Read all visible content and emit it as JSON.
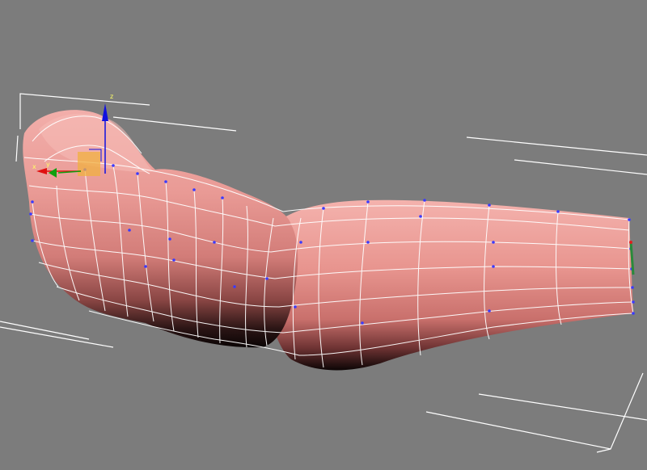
{
  "viewport": {
    "background": "#7c7c7c",
    "view": "perspective"
  },
  "model": {
    "type": "editable-poly",
    "subobject_level": "vertex",
    "color": "#e59d98",
    "wire_color": "#ffffff",
    "vertex_color": "#3a3aff"
  },
  "gizmo": {
    "mode": "move",
    "axis_x_label": "x",
    "axis_y_label": "y",
    "axis_z_label": "z",
    "x_color": "#e01010",
    "y_color": "#10a010",
    "z_color": "#1010e0",
    "plane_color": "#f0b040"
  },
  "selection_bracket_color": "#ffffff"
}
